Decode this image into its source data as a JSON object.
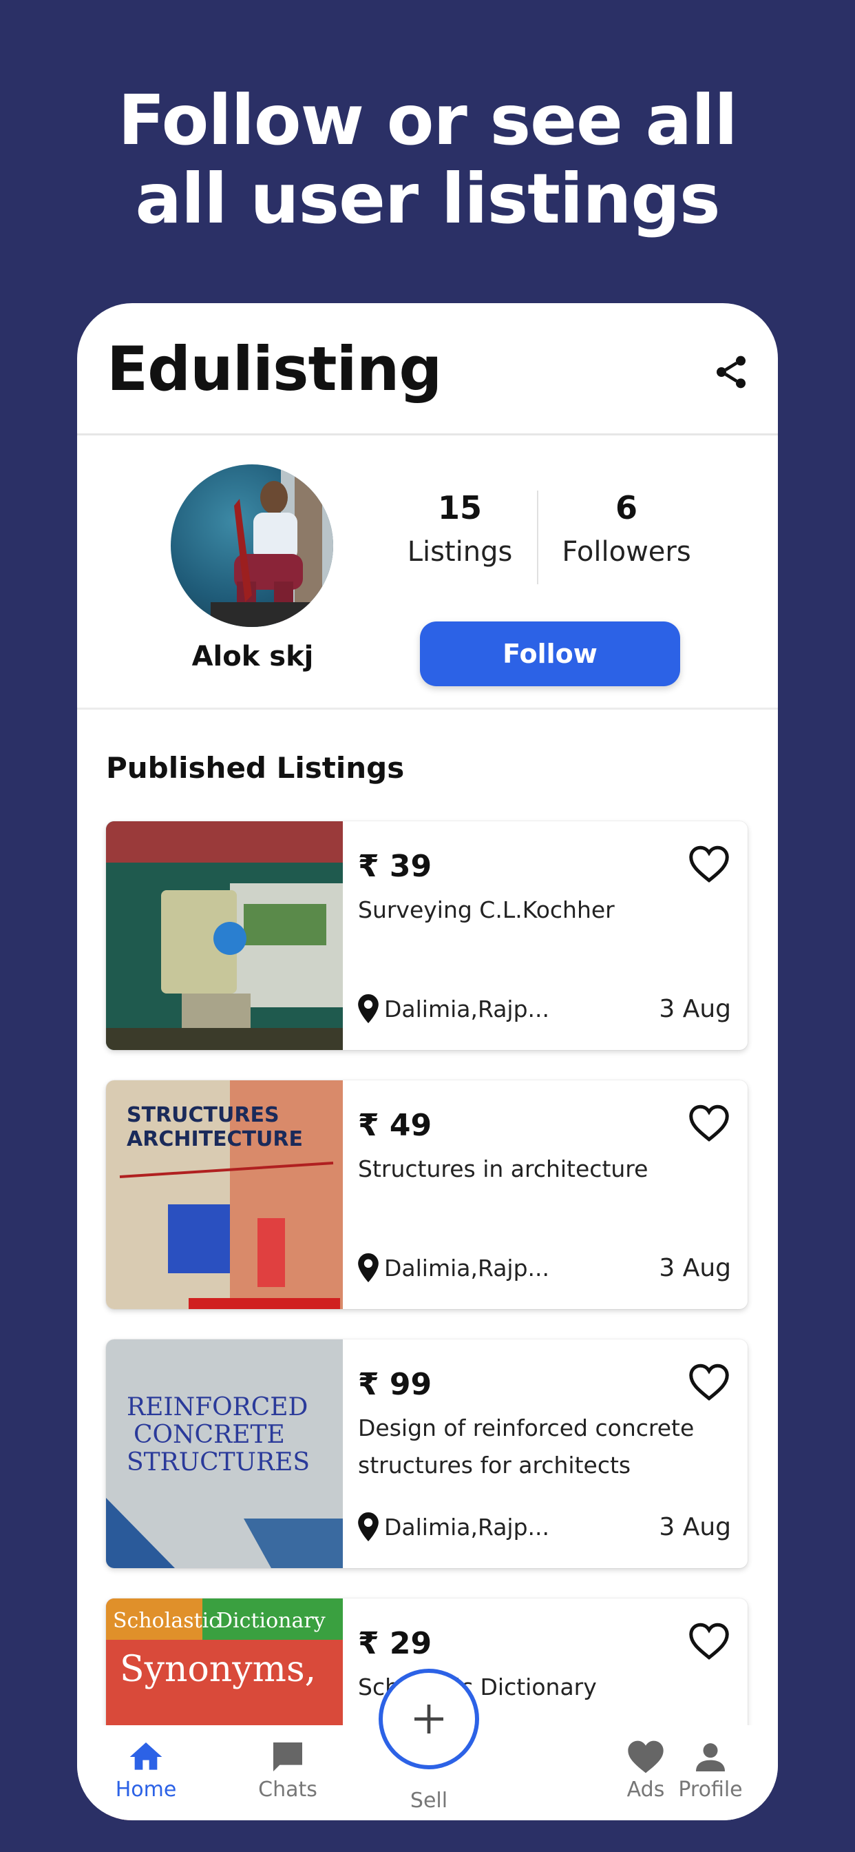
{
  "headline": {
    "line1": "Follow or see all",
    "line2": "all user listings"
  },
  "app": {
    "title": "Edulisting",
    "share_icon": "share-icon"
  },
  "profile": {
    "name": "Alok skj",
    "listings_count": "15",
    "listings_label": "Listings",
    "followers_count": "6",
    "followers_label": "Followers",
    "follow_label": "Follow"
  },
  "section": {
    "title": "Published Listings"
  },
  "listings": [
    {
      "price": "₹ 39",
      "title": "Surveying C.L.Kochher",
      "location": "Dalimia,Rajp...",
      "date": "3 Aug"
    },
    {
      "price": "₹ 49",
      "title": "Structures in architecture",
      "location": "Dalimia,Rajp...",
      "date": "3 Aug"
    },
    {
      "price": "₹ 99",
      "title": "Design of reinforced concrete structures for architects",
      "location": "Dalimia,Rajp...",
      "date": "3 Aug"
    },
    {
      "price": "₹ 29",
      "title": "Scholastic Dictionary",
      "location": "",
      "date": ""
    }
  ],
  "nav": {
    "home": "Home",
    "chats": "Chats",
    "sell": "Sell",
    "ads": "Ads",
    "profile": "Profile"
  },
  "colors": {
    "background": "#2b3066",
    "accent": "#2c62e6"
  }
}
